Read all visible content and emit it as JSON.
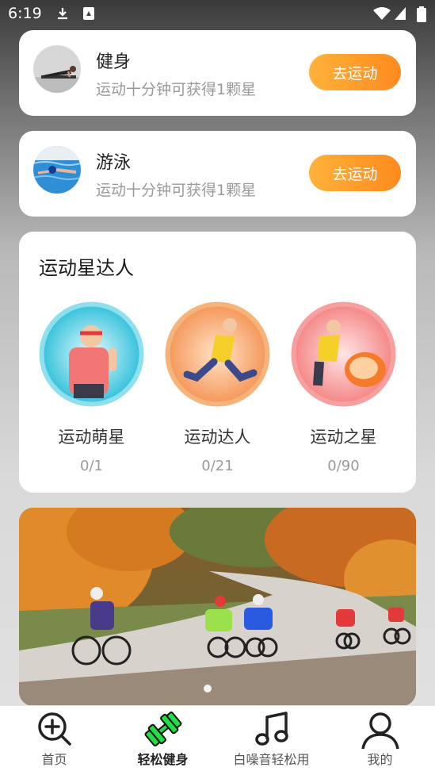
{
  "status_bar": {
    "time": "6:19"
  },
  "exercises": [
    {
      "title": "健身",
      "desc": "运动十分钟可获得1颗星",
      "button": "去运动"
    },
    {
      "title": "游泳",
      "desc": "运动十分钟可获得1颗星",
      "button": "去运动"
    }
  ],
  "stars": {
    "title": "运动星达人",
    "badges": [
      {
        "name": "运动萌星",
        "progress": "0/1"
      },
      {
        "name": "运动达人",
        "progress": "0/21"
      },
      {
        "name": "运动之星",
        "progress": "0/90"
      }
    ]
  },
  "tabs": [
    {
      "label": "首页",
      "icon": "zoom-in-icon"
    },
    {
      "label": "轻松健身",
      "icon": "dumbbell-icon",
      "active": true
    },
    {
      "label": "白噪音轻松用",
      "icon": "music-note-icon"
    },
    {
      "label": "我的",
      "icon": "user-icon"
    }
  ],
  "colors": {
    "accent": "#ff9a2a",
    "active_tab": "#22dd44"
  }
}
